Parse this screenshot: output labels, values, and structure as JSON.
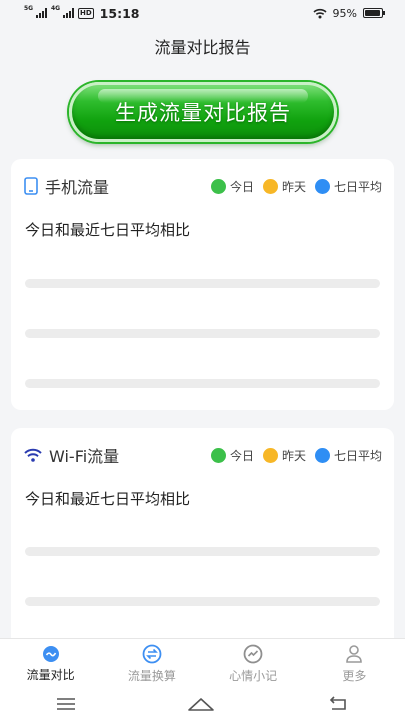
{
  "status_bar": {
    "net1": "5G",
    "net2": "4G",
    "hd": "HD",
    "time": "15:18",
    "battery": "95%",
    "battery_level": 0.95
  },
  "header": {
    "title": "流量对比报告"
  },
  "generate_button": {
    "label": "生成流量对比报告"
  },
  "legend": [
    {
      "label": "今日",
      "color": "#3cc04a"
    },
    {
      "label": "昨天",
      "color": "#f7b727"
    },
    {
      "label": "七日平均",
      "color": "#2f8ef4"
    }
  ],
  "cards": [
    {
      "title": "手机流量",
      "icon": "phone-icon",
      "subtitle": "今日和最近七日平均相比"
    },
    {
      "title": "Wi-Fi流量",
      "icon": "wifi-icon",
      "subtitle": "今日和最近七日平均相比"
    }
  ],
  "tabs": [
    {
      "label": "流量对比",
      "icon": "traffic-compare-icon",
      "active": true
    },
    {
      "label": "流量换算",
      "icon": "convert-icon",
      "active": false
    },
    {
      "label": "心情小记",
      "icon": "mood-icon",
      "active": false
    },
    {
      "label": "更多",
      "icon": "user-icon",
      "active": false
    }
  ],
  "colors": {
    "accent": "#2a9a2a",
    "tab_active_icon": "#3d8ff2",
    "tab_inactive": "#9a9a9a"
  }
}
